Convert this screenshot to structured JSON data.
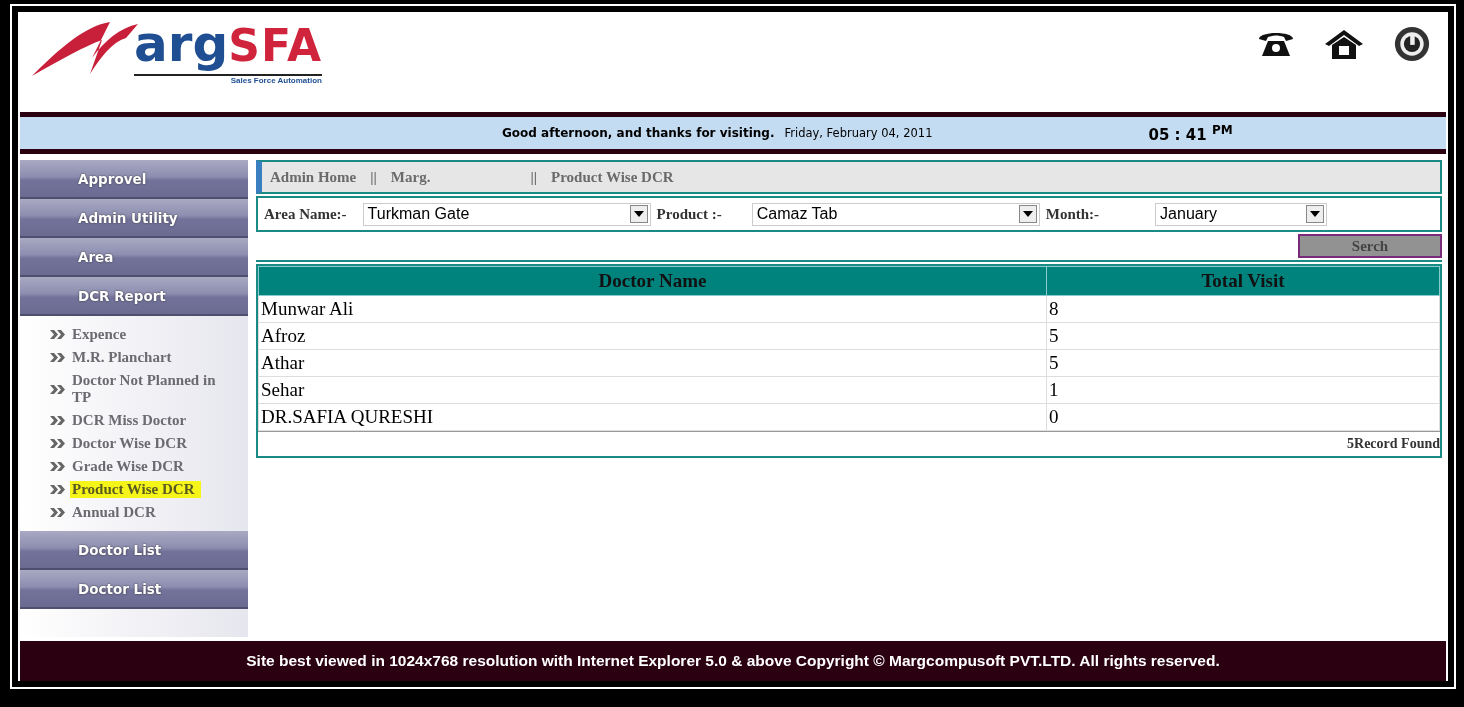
{
  "logo": {
    "text_1": "arg",
    "text_2": "SFA",
    "tagline": "Sales Force Automation"
  },
  "greeting_bar": {
    "message": "Good afternoon, and thanks for visiting.",
    "date": "Friday, February 04, 2011",
    "time": "05 : 41",
    "meridiem": "PM"
  },
  "sidebar": {
    "items": [
      {
        "label": "Approvel"
      },
      {
        "label": "Admin Utility"
      },
      {
        "label": "Area"
      },
      {
        "label": "DCR Report",
        "children": [
          {
            "label": "Expence",
            "selected": false
          },
          {
            "label": "M.R. Planchart",
            "selected": false
          },
          {
            "label": "Doctor Not Planned in TP",
            "selected": false
          },
          {
            "label": "DCR Miss Doctor",
            "selected": false
          },
          {
            "label": "Doctor Wise DCR",
            "selected": false
          },
          {
            "label": "Grade Wise DCR",
            "selected": false
          },
          {
            "label": "Product Wise DCR",
            "selected": true
          },
          {
            "label": "Annual DCR",
            "selected": false
          }
        ]
      },
      {
        "label": "Doctor List"
      },
      {
        "label": "Doctor List"
      }
    ]
  },
  "breadcrumb": [
    {
      "kind": "link",
      "text": "Admin Home"
    },
    {
      "kind": "separator",
      "text": "||"
    },
    {
      "kind": "link",
      "text": "Marg."
    },
    {
      "kind": "separator",
      "text": "||"
    },
    {
      "kind": "link",
      "text": "Product Wise DCR"
    }
  ],
  "filters": [
    {
      "label": "Area Name:-",
      "value": "Turkman Gate"
    },
    {
      "label": "Product :-",
      "value": "Camaz Tab"
    },
    {
      "label": "Month:-",
      "value": "January"
    }
  ],
  "search_button": "Serch",
  "table": {
    "columns": [
      "Doctor Name",
      "Total Visit"
    ],
    "rows": [
      [
        "Munwar Ali",
        "8"
      ],
      [
        "Afroz",
        "5"
      ],
      [
        "Athar",
        "5"
      ],
      [
        "Sehar",
        "1"
      ],
      [
        "DR.SAFIA QURESHI",
        "0"
      ]
    ]
  },
  "record_count": "5Record Found",
  "footer": "Site best viewed in 1024x768 resolution with Internet Explorer 5.0 & above Copyright © Margcompusoft PVT.LTD. All rights reserved."
}
